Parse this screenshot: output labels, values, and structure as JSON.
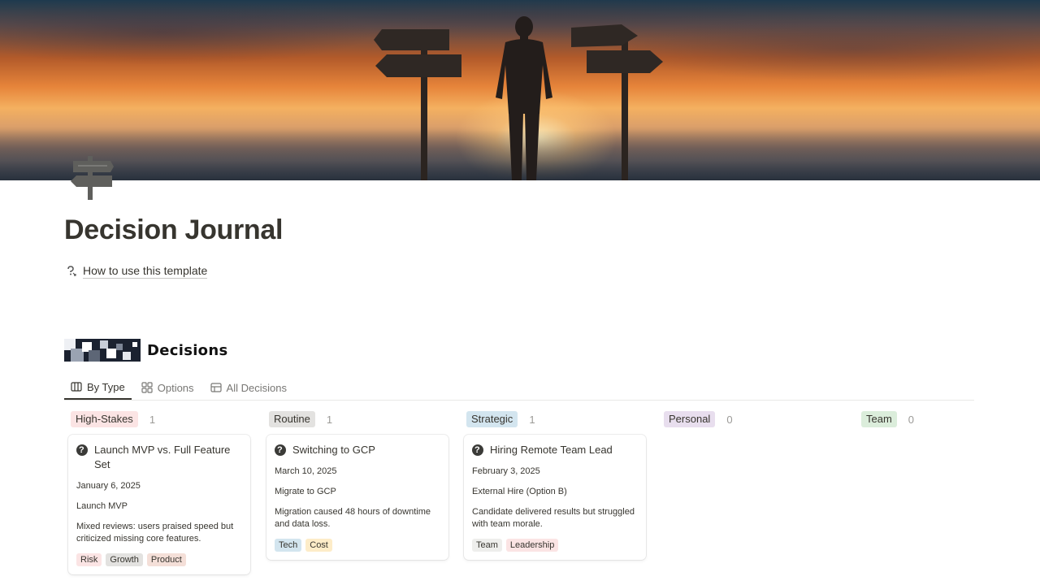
{
  "page": {
    "title": "Decision Journal",
    "how_to_label": "How to use this template"
  },
  "database": {
    "banner_label": "Decisions",
    "tabs": [
      {
        "label": "By Type",
        "icon": "board-icon",
        "active": true
      },
      {
        "label": "Options",
        "icon": "gallery-icon",
        "active": false
      },
      {
        "label": "All Decisions",
        "icon": "table-icon",
        "active": false
      }
    ]
  },
  "board": {
    "columns": [
      {
        "label": "High-Stakes",
        "count": "1",
        "color": "#fbe4e4"
      },
      {
        "label": "Routine",
        "count": "1",
        "color": "#e3e2e0"
      },
      {
        "label": "Strategic",
        "count": "1",
        "color": "#d3e5ef"
      },
      {
        "label": "Personal",
        "count": "0",
        "color": "#e8deee"
      },
      {
        "label": "Team",
        "count": "0",
        "color": "#dbeddb"
      }
    ],
    "cards": [
      {
        "title": "Launch MVP vs. Full Feature Set",
        "date": "January 6, 2025",
        "choice": "Launch MVP",
        "outcome": "Mixed reviews: users praised speed but criticized missing core features.",
        "tags": [
          {
            "label": "Risk",
            "color": "#fbe4e4"
          },
          {
            "label": "Growth",
            "color": "#e3e2e0"
          },
          {
            "label": "Product",
            "color": "#f4dfd8"
          }
        ]
      },
      {
        "title": "Switching to GCP",
        "date": "March 10, 2025",
        "choice": "Migrate to GCP",
        "outcome": "Migration caused 48 hours of downtime and data loss.",
        "tags": [
          {
            "label": "Tech",
            "color": "#d3e5ef"
          },
          {
            "label": "Cost",
            "color": "#fdecc8"
          }
        ]
      },
      {
        "title": "Hiring Remote Team Lead",
        "date": "February 3, 2025",
        "choice": "External Hire (Option B)",
        "outcome": "Candidate delivered results but struggled with team morale.",
        "tags": [
          {
            "label": "Team",
            "color": "#eeeeec"
          },
          {
            "label": "Leadership",
            "color": "#fbe4e4"
          }
        ]
      }
    ]
  }
}
